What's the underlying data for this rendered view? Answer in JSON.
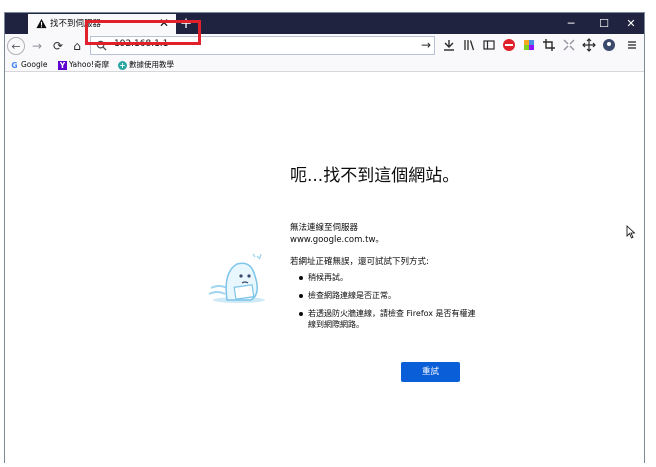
{
  "tab": {
    "title": "找不到伺服器",
    "close": "✕"
  },
  "newtab": "+",
  "window": {
    "minimize": "─",
    "maximize": "☐",
    "close": "✕"
  },
  "nav": {
    "back": "←",
    "forward": "→",
    "reload": "⟳",
    "home": "⌂"
  },
  "url": {
    "value": "192.168.1.1",
    "go": "→"
  },
  "bookmarks": [
    {
      "icon": "G",
      "label": "Google"
    },
    {
      "icon": "Y",
      "label": "Yahoo!奇摩"
    },
    {
      "icon": "+",
      "label": "數據使用教學"
    }
  ],
  "error": {
    "title": "呃...找不到這個網站。",
    "desc_line1": "無法連線至伺服器",
    "desc_line2": "www.google.com.tw。",
    "suggest": "若網址正確無誤，還可試試下列方式:",
    "items": [
      "稍候再試。",
      "檢查網路連線是否正常。",
      "若透過防火牆連線，請檢查 Firefox 是否有權連線到網際網路。"
    ],
    "retry": "重試"
  },
  "colors": {
    "titlebar": "#202340",
    "retry": "#0a5fd8",
    "highlight": "#e0202a"
  }
}
